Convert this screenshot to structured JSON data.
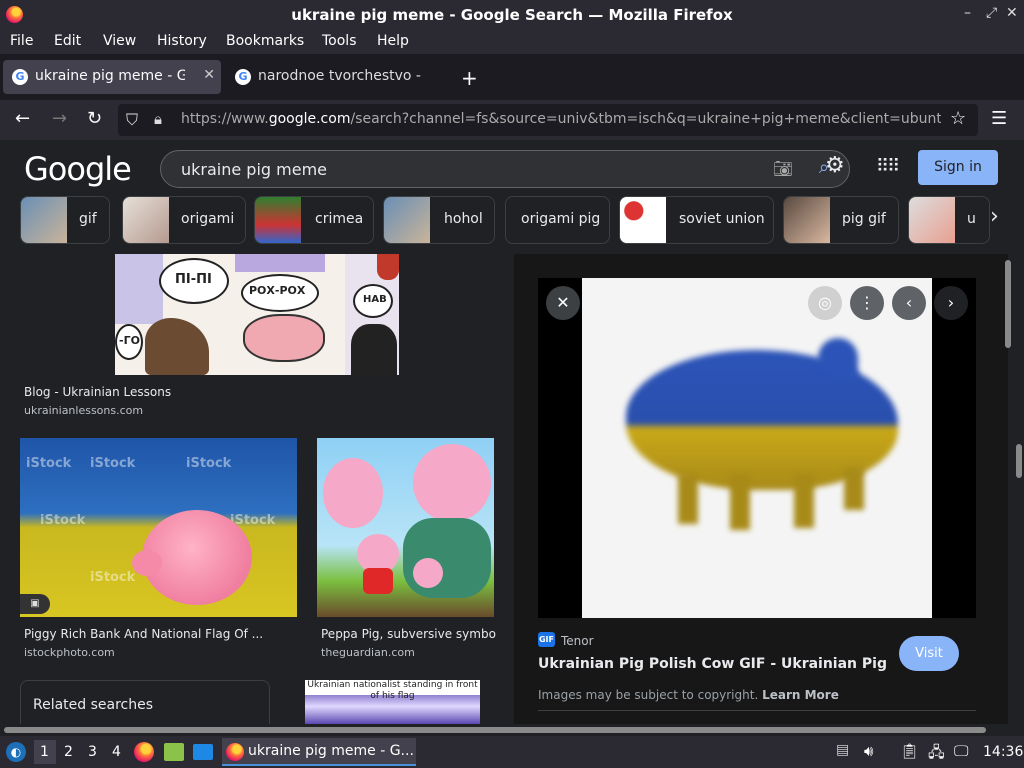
{
  "window": {
    "title": "ukraine pig meme - Google Search — Mozilla Firefox"
  },
  "menu": [
    "File",
    "Edit",
    "View",
    "History",
    "Bookmarks",
    "Tools",
    "Help"
  ],
  "tabs": [
    {
      "label": "ukraine pig meme - Goog",
      "active": true
    },
    {
      "label": "narodnoe tvorchestvo - G",
      "active": false
    }
  ],
  "nav": {
    "url_prefix": "https://www.",
    "url_domain": "google.com",
    "url_path": "/search?channel=fs&source=univ&tbm=isch&q=ukraine+pig+meme&client=ubuntu"
  },
  "google": {
    "logo": "Google",
    "query": "ukraine pig meme",
    "signin": "Sign in",
    "chips": [
      "gif",
      "origami",
      "crimea",
      "hohol",
      "origami pig",
      "soviet union",
      "pig gif",
      "u"
    ]
  },
  "results": {
    "blog": {
      "title": "Blog - Ukrainian Lessons",
      "source": "ukrainianlessons.com"
    },
    "istock": {
      "title": "Piggy Rich Bank And National Flag Of ...",
      "source": "istockphoto.com",
      "watermark": "iStock"
    },
    "peppa": {
      "title": "Peppa Pig, subversive symbo...",
      "source": "theguardian.com"
    },
    "related": "Related searches",
    "partial_caption": "Ukrainian nationalist standing in front of his flag",
    "comic_texts": [
      "ПІ-ПІ",
      "РОХ-РОХ",
      "НАВ",
      "-ГО"
    ]
  },
  "preview": {
    "source_badge": "GIF",
    "source_name": "Tenor",
    "title": "Ukrainian Pig Polish Cow GIF - Ukrainian Pig Pig Po...",
    "visit": "Visit",
    "copyright": "Images may be subject to copyright.",
    "learn_more": "Learn More"
  },
  "taskbar": {
    "workspaces": [
      "1",
      "2",
      "3",
      "4"
    ],
    "active_window": "ukraine pig meme - G...",
    "clock": "14:36"
  }
}
